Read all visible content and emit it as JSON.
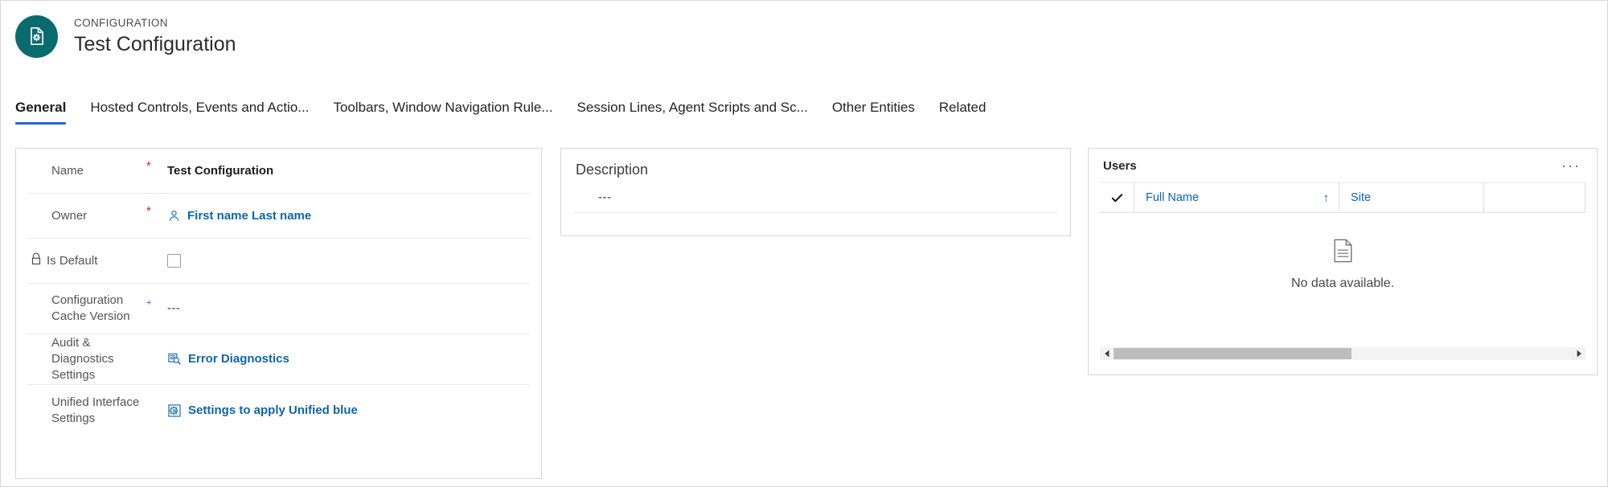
{
  "header": {
    "eyebrow": "CONFIGURATION",
    "title": "Test Configuration",
    "badge_icon": "document-settings-icon",
    "badge_color": "#0b6a6e"
  },
  "tabs": [
    {
      "label": "General",
      "active": true
    },
    {
      "label": "Hosted Controls, Events and Actio...",
      "active": false
    },
    {
      "label": "Toolbars, Window Navigation Rule...",
      "active": false
    },
    {
      "label": "Session Lines, Agent Scripts and Sc...",
      "active": false
    },
    {
      "label": "Other Entities",
      "active": false
    },
    {
      "label": "Related",
      "active": false
    }
  ],
  "accent_color": "#2266cc",
  "link_color": "#1264a3",
  "required_color": "#c8291d",
  "recommended_color": "#3b5bd6",
  "general_panel": {
    "fields": [
      {
        "label": "Name",
        "required_mark": "*",
        "required_kind": "required",
        "value": "Test Configuration",
        "value_kind": "text-bold",
        "icon": ""
      },
      {
        "label": "Owner",
        "required_mark": "*",
        "required_kind": "required",
        "value": "First name Last name",
        "value_kind": "link",
        "icon": "person-icon"
      },
      {
        "label": "Is Default",
        "label_icon": "lock-icon",
        "required_mark": "",
        "required_kind": "none",
        "value": "",
        "value_kind": "checkbox",
        "checked": false,
        "icon": ""
      },
      {
        "label": "Configuration Cache Version",
        "required_mark": "+",
        "required_kind": "recommended",
        "value": "---",
        "value_kind": "text-muted",
        "icon": ""
      },
      {
        "label": "Audit & Diagnostics Settings",
        "required_mark": "",
        "required_kind": "none",
        "value": "Error Diagnostics",
        "value_kind": "link",
        "icon": "diagnostics-icon"
      },
      {
        "label": "Unified Interface Settings",
        "required_mark": "",
        "required_kind": "none",
        "value": "Settings to apply Unified blue",
        "value_kind": "link",
        "icon": "gear-box-icon"
      }
    ]
  },
  "description_panel": {
    "title": "Description",
    "value": "---"
  },
  "users_panel": {
    "title": "Users",
    "more_label": "···",
    "columns": [
      {
        "label": "Full Name",
        "sort_indicator": "↑"
      },
      {
        "label": "Site",
        "sort_indicator": ""
      },
      {
        "label": "",
        "sort_indicator": ""
      }
    ],
    "select_all_icon": "checkmark-icon",
    "empty_icon": "document-icon",
    "empty_text": "No data available.",
    "scroll": {
      "left_arrow": "◀",
      "right_arrow": "▶",
      "thumb_percent": 52
    }
  }
}
